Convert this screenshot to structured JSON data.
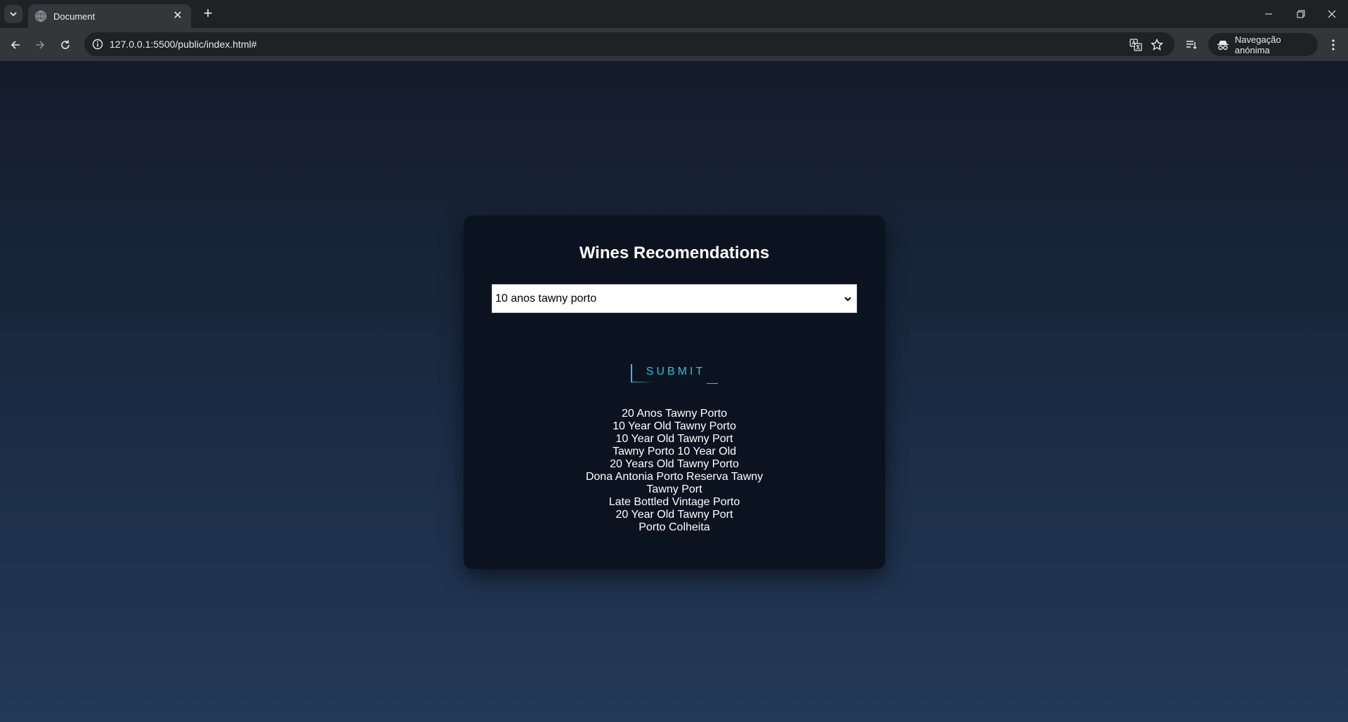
{
  "browser": {
    "tab_title": "Document",
    "url": "127.0.0.1:5500/public/index.html#",
    "incognito_label": "Navegação anónima"
  },
  "page": {
    "title": "Wines Recomendations",
    "select": {
      "selected": "10 anos tawny porto"
    },
    "submit_label": "SUBMIT",
    "results": [
      "20 Anos Tawny Porto",
      "10 Year Old Tawny Porto",
      "10 Year Old Tawny Port",
      "Tawny Porto 10 Year Old",
      "20 Years Old Tawny Porto",
      "Dona Antonia Porto Reserva Tawny",
      "Tawny Port",
      "Late Bottled Vintage Porto",
      "20 Year Old Tawny Port",
      "Porto Colheita"
    ]
  },
  "colors": {
    "accent": "#2bc2d9",
    "card_bg": "#0c1320",
    "page_bg_top": "#141c2b",
    "page_bg_bottom": "#233a58"
  }
}
